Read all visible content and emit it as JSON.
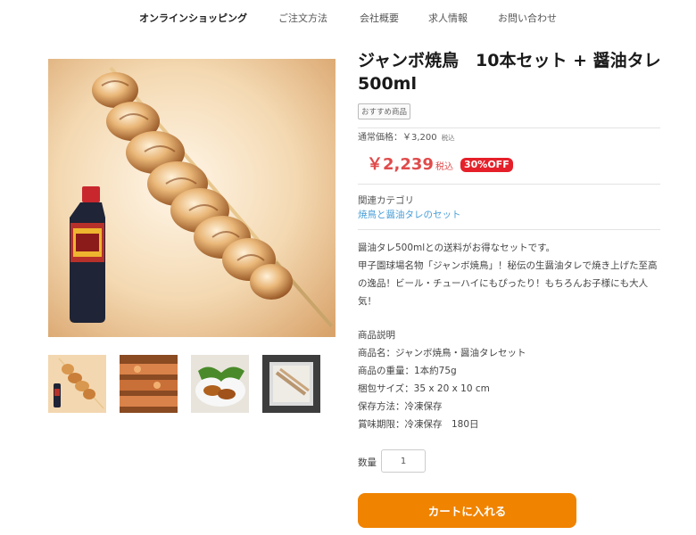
{
  "nav": {
    "items": [
      {
        "label": "オンラインショッピング"
      },
      {
        "label": "ご注文方法"
      },
      {
        "label": "会社概要"
      },
      {
        "label": "求人情報"
      },
      {
        "label": "お問い合わせ"
      }
    ]
  },
  "product": {
    "title": "ジャンボ焼鳥　10本セット + 醤油タレ500ml",
    "badge": "おすすめ商品",
    "regular_price": "通常価格：￥3,200",
    "regular_tax": "税込",
    "sale_price": "￥2,239",
    "sale_tax": "税込",
    "discount": "30%OFF",
    "category_label": "関連カテゴリ",
    "category_link": "焼鳥と醤油タレのセット",
    "description": [
      "醤油タレ500mlとの送料がお得なセットです。",
      "甲子園球場名物「ジャンボ焼鳥」！秘伝の生醤油タレで焼き上げた至高の逸品！ビール・チューハイにもぴったり！もちろんお子様にも大人気！"
    ],
    "specs": [
      "商品説明",
      "商品名：ジャンボ焼鳥・醤油タレセット",
      "商品の重量：1本約75g",
      "梱包サイズ：35 x 20 x 10 cm",
      "保存方法：冷凍保存",
      "賞味期限：冷凍保存　180日"
    ],
    "bottle_label": "焼鳥のたれ",
    "quantity_label": "数量",
    "quantity_value": "1",
    "cart_button": "カートに入れる"
  },
  "colors": {
    "accent_orange": "#f08300",
    "price_red": "#e04b4b",
    "badge_red": "#e5202a",
    "link_blue": "#4a9fd8"
  }
}
